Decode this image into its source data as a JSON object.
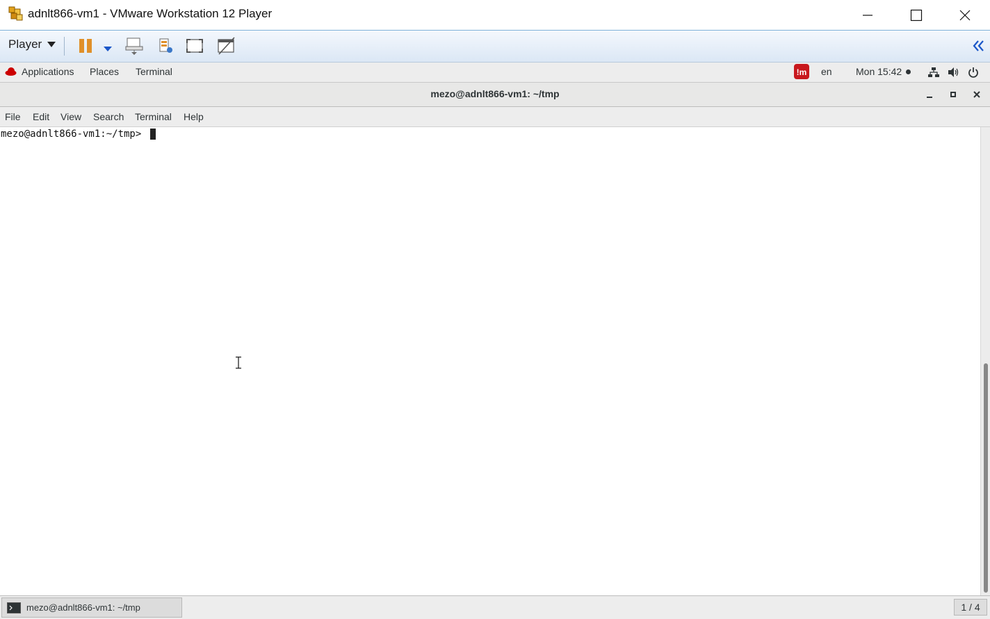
{
  "window": {
    "title": "adnlt866-vm1 - VMware Workstation 12 Player",
    "icon": "vmware-player-icon",
    "controls": [
      "minimize-icon",
      "maximize-icon",
      "close-icon"
    ]
  },
  "vmware_toolbar": {
    "player_label": "Player",
    "buttons": [
      "pause-icon",
      "pause-dropdown-icon",
      "send-ctrl-alt-del-icon",
      "removable-devices-icon",
      "full-screen-icon",
      "unity-icon"
    ],
    "collapse_icon": "double-chevron-left-icon",
    "accent": "#1a56c8"
  },
  "gnome_bar": {
    "applications": "Applications",
    "places": "Places",
    "terminal": "Terminal",
    "input_method_icon": "input-method-icon",
    "language": "en",
    "clock": "Mon 15:42",
    "status_icons": [
      "network-icon",
      "volume-icon",
      "power-icon"
    ]
  },
  "terminal_window": {
    "title": "mezo@adnlt866-vm1: ~/tmp",
    "menu": [
      "File",
      "Edit",
      "View",
      "Search",
      "Terminal",
      "Help"
    ],
    "prompt": "mezo@adnlt866-vm1:~/tmp> "
  },
  "taskbar": {
    "task_label": "mezo@adnlt866-vm1: ~/tmp",
    "workspace": "1 / 4"
  }
}
